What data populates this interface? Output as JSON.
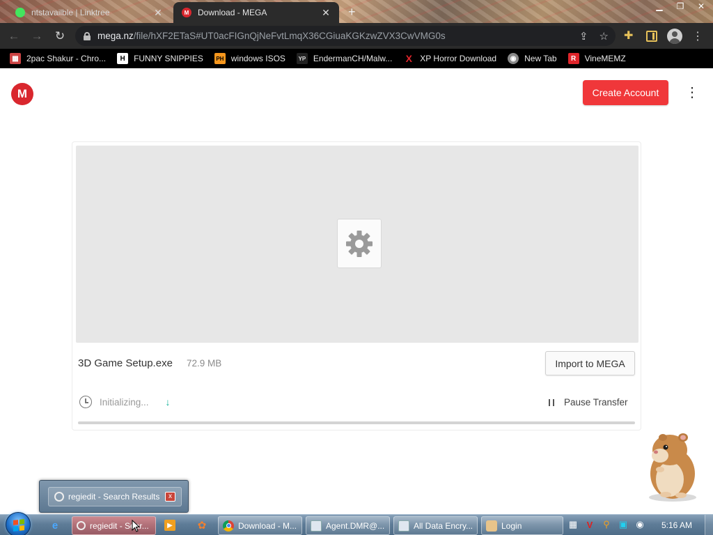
{
  "browser": {
    "tabs": [
      {
        "title": "ntstavailble | Linktree",
        "active": false,
        "favicon_color": "#43e55e"
      },
      {
        "title": "Download - MEGA",
        "active": true,
        "favicon_color": "#d9272e"
      }
    ],
    "new_tab_symbol": "+",
    "address": {
      "host": "mega.nz",
      "path": "/file/hXF2ETaS#UT0acFIGnQjNeFvtLmqX36CGiuaKGKzwZVX3CwVMG0s"
    },
    "bookmarks": [
      {
        "label": "2pac Shakur - Chro...",
        "icon": "calendar-icon",
        "icon_text": "",
        "icon_bg": "#c44",
        "icon_fg": "#fff"
      },
      {
        "label": "FUNNY SNIPPIES",
        "icon": "h-icon",
        "icon_text": "H",
        "icon_bg": "#fff",
        "icon_fg": "#000"
      },
      {
        "label": "windows ISOS",
        "icon": "ph-icon",
        "icon_text": "PH",
        "icon_bg": "#f7971d",
        "icon_fg": "#000"
      },
      {
        "label": "EndermanCH/Malw...",
        "icon": "yp-icon",
        "icon_text": "YP",
        "icon_bg": "#222",
        "icon_fg": "#ddd"
      },
      {
        "label": "XP Horror Download",
        "icon": "x-icon",
        "icon_text": "X",
        "icon_bg": "transparent",
        "icon_fg": "#e0252b"
      },
      {
        "label": "New Tab",
        "icon": "globe-icon",
        "icon_text": "",
        "icon_bg": "#999",
        "icon_fg": "#fff"
      },
      {
        "label": "VineMEMZ",
        "icon": "r-icon",
        "icon_text": "R",
        "icon_bg": "#e0252b",
        "icon_fg": "#fff"
      }
    ]
  },
  "page": {
    "logo_letter": "M",
    "create_account_label": "Create Account",
    "file_name": "3D Game Setup.exe",
    "file_size": "72.9 MB",
    "import_label": "Import to MEGA",
    "status_text": "Initializing...",
    "pause_label": "Pause Transfer",
    "progress_fraction": 0,
    "accent_color": "#f0373a"
  },
  "popup": {
    "title": "regiedit - Search Results",
    "close_symbol": "x"
  },
  "taskbar": {
    "buttons": [
      {
        "label": "regiedit - Sear...",
        "icon": "regiedit-icon",
        "active": true
      },
      {
        "label": "Download - M...",
        "icon": "chrome-icon",
        "active": false
      },
      {
        "label": "Agent.DMR@...",
        "icon": "window-icon",
        "active": false
      },
      {
        "label": "All Data Encry...",
        "icon": "folder-icon",
        "active": false
      },
      {
        "label": "Login",
        "icon": "login-icon",
        "active": false
      }
    ],
    "clock": "5:16 AM"
  }
}
